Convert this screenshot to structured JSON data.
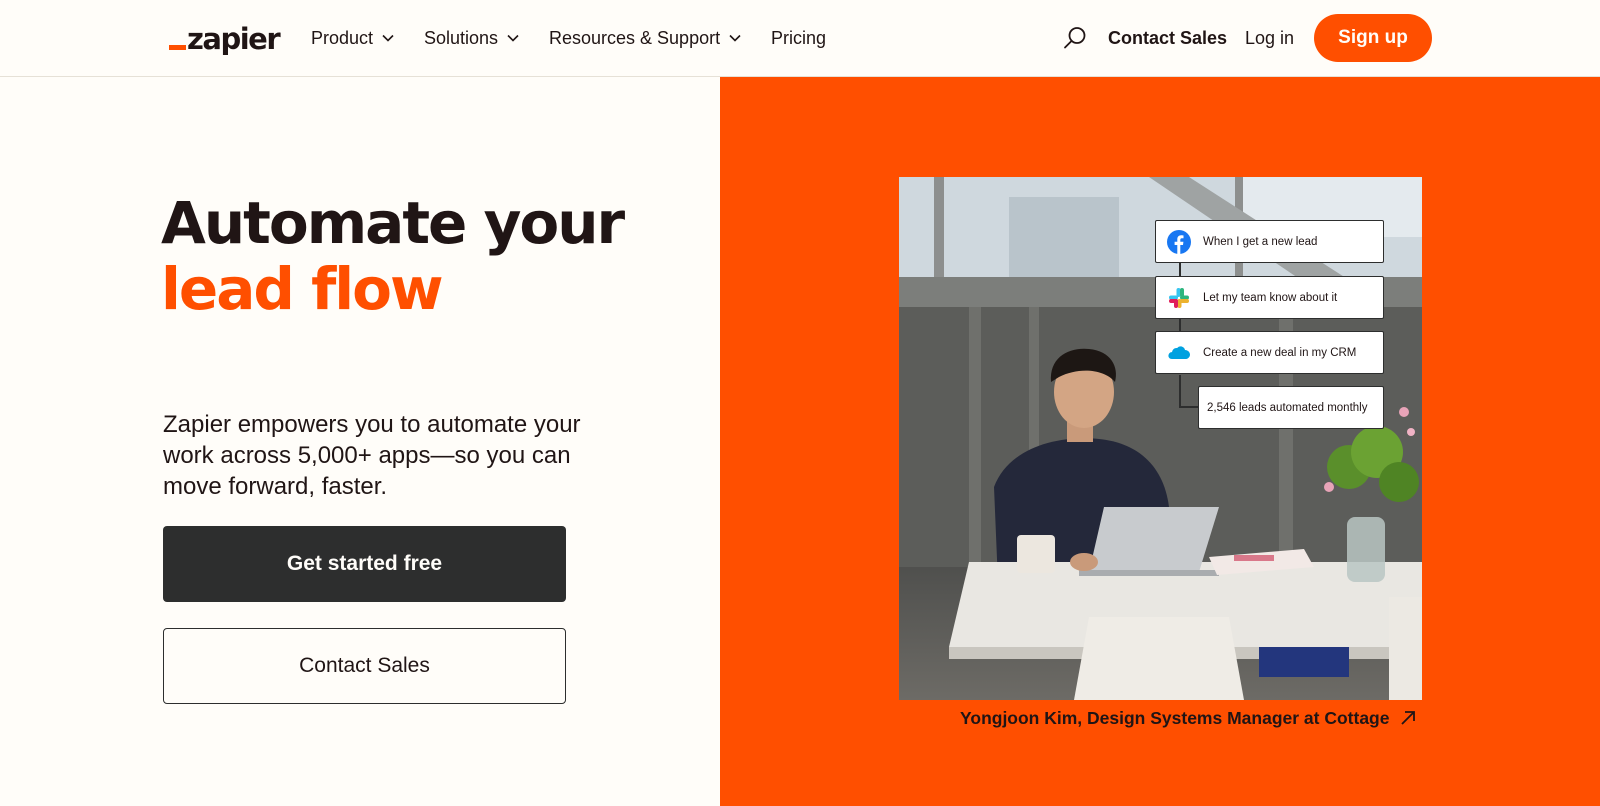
{
  "brand": {
    "name": "zapier",
    "accent": "#ff4f00",
    "dark": "#201515",
    "cream": "#fffdf9"
  },
  "nav": {
    "items": [
      {
        "label": "Product",
        "icon": "chevron-down-icon"
      },
      {
        "label": "Solutions",
        "icon": "chevron-down-icon"
      },
      {
        "label": "Resources & Support",
        "icon": "chevron-down-icon"
      },
      {
        "label": "Pricing"
      }
    ],
    "search_icon": "search-icon",
    "contact_sales": "Contact Sales",
    "log_in": "Log in",
    "sign_up": "Sign up"
  },
  "hero": {
    "title_line1": "Automate your",
    "title_line2": "lead flow",
    "description": "Zapier empowers you to automate your work across 5,000+ apps—so you can move forward, faster.",
    "primary_cta": "Get started free",
    "secondary_cta": "Contact Sales"
  },
  "workflow": {
    "steps": [
      {
        "label": "When I get a new lead",
        "icon": "facebook-icon"
      },
      {
        "label": "Let my team know about it",
        "icon": "slack-icon"
      },
      {
        "label": "Create a new deal in my CRM",
        "icon": "salesforce-icon"
      }
    ],
    "stat": "2,546 leads automated monthly"
  },
  "caption": {
    "text": "Yongjoon Kim, Design Systems Manager at Cottage",
    "icon": "arrow-up-right-icon"
  }
}
